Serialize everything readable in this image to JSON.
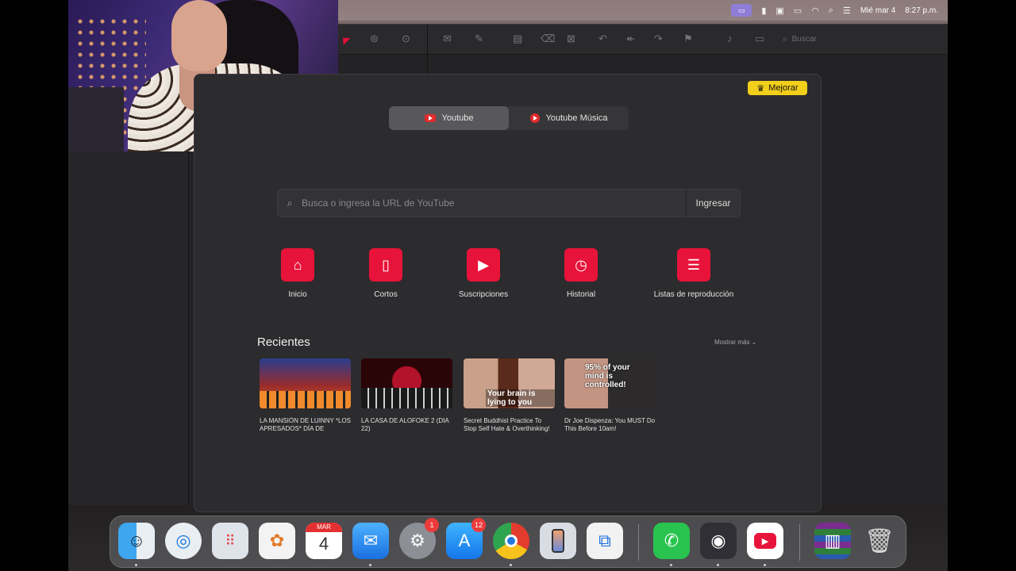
{
  "menubar": {
    "date": "Mié mar 4",
    "time": "8:27 p.m."
  },
  "mail": {
    "search_placeholder": "Buscar"
  },
  "app": {
    "upgrade_label": "Mejorar",
    "tabs": [
      {
        "label": "Youtube",
        "active": true
      },
      {
        "label": "Youtube Música",
        "active": false
      }
    ],
    "search": {
      "placeholder": "Busca o ingresa la URL de YouTube",
      "button_label": "Ingresar"
    },
    "quick_actions": [
      {
        "label": "Inicio",
        "icon": "home-icon"
      },
      {
        "label": "Cortos",
        "icon": "shorts-icon"
      },
      {
        "label": "Suscripciones",
        "icon": "subscriptions-icon"
      },
      {
        "label": "Historial",
        "icon": "history-icon"
      },
      {
        "label": "Listas de reproducción",
        "icon": "playlist-icon"
      }
    ],
    "recents": {
      "title": "Recientes",
      "more_label": "Mostrar más",
      "items": [
        {
          "title": "LA MANSIÓN DE LUINNY *LOS APRESADOS* DÍA DE NOMIN…",
          "overlay": ""
        },
        {
          "title": "LA CASA DE ALOFOKE 2 (DIA 22)",
          "overlay": ""
        },
        {
          "title": "Secret Buddhist Practice To Stop Self Hate & Overthinking!",
          "overlay": "Your brain is lying to you"
        },
        {
          "title": "Dr Joe Dispenza: You MUST Do This Before 10am!",
          "overlay": "95% of your mind is controlled!"
        }
      ]
    }
  },
  "dock": {
    "items": [
      {
        "name": "Finder",
        "icon": "finder-icon"
      },
      {
        "name": "Safari",
        "icon": "safari-icon"
      },
      {
        "name": "Launchpad",
        "icon": "launchpad-icon"
      },
      {
        "name": "Photos",
        "icon": "photos-icon"
      },
      {
        "name": "Calendar",
        "icon": "calendar-icon",
        "month": "MAR",
        "day": "4"
      },
      {
        "name": "Mail",
        "icon": "mail-icon"
      },
      {
        "name": "System Settings",
        "icon": "settings-icon",
        "badge": "1"
      },
      {
        "name": "App Store",
        "icon": "app-store-icon",
        "badge": "12"
      },
      {
        "name": "Chrome",
        "icon": "chrome-icon"
      },
      {
        "name": "iPhone Mirroring",
        "icon": "iphone-mirroring-icon"
      },
      {
        "name": "Screen Sharing",
        "icon": "screen-sharing-icon"
      },
      {
        "name": "WhatsApp",
        "icon": "whatsapp-icon"
      },
      {
        "name": "OBS",
        "icon": "obs-icon"
      },
      {
        "name": "YouTube",
        "icon": "youtube-app-icon"
      },
      {
        "name": "WinRAR",
        "icon": "winrar-icon"
      },
      {
        "name": "Trash",
        "icon": "trash-icon"
      }
    ]
  }
}
